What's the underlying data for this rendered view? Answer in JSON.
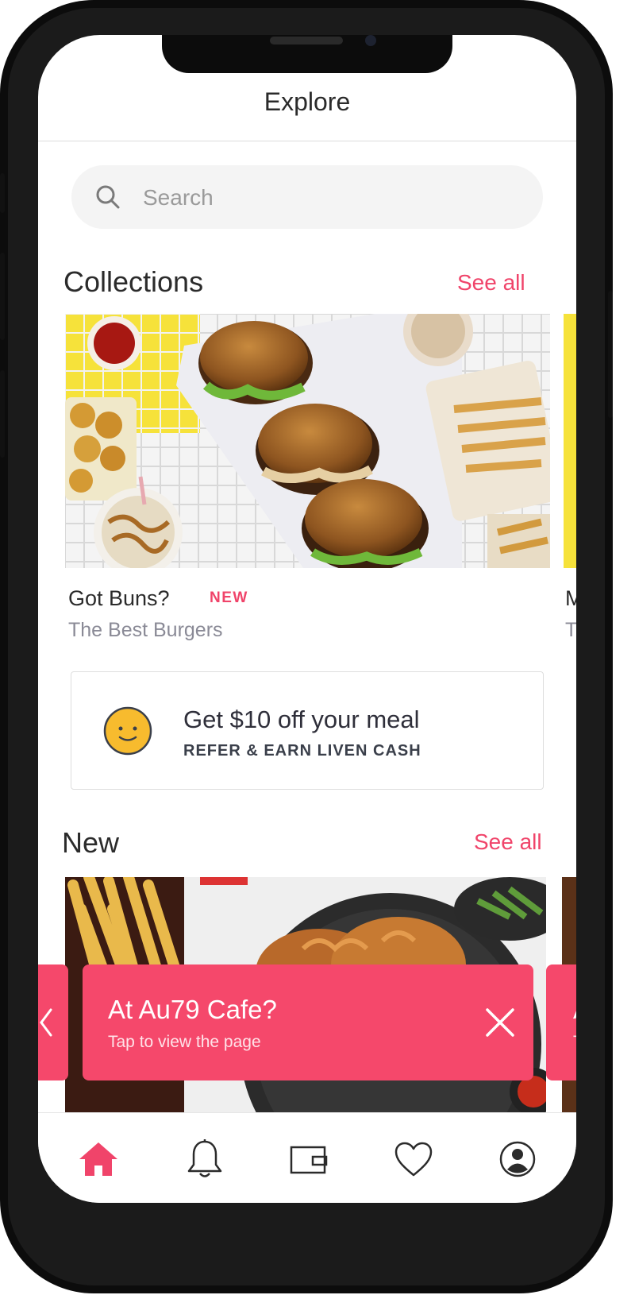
{
  "header": {
    "title": "Explore"
  },
  "search": {
    "placeholder": "Search"
  },
  "collections": {
    "title": "Collections",
    "see_all": "See all",
    "items": [
      {
        "name": "Got Buns?",
        "badge": "NEW",
        "subtitle": "The Best Burgers"
      },
      {
        "name": "M",
        "subtitle": "T"
      }
    ]
  },
  "promo": {
    "title": "Get $10 off your meal",
    "subtitle": "REFER & EARN LIVEN CASH"
  },
  "new_section": {
    "title": "New",
    "see_all": "See all"
  },
  "location_banner": {
    "title": "At Au79 Cafe?",
    "subtitle": "Tap to view the page",
    "next_peek_title": "A",
    "next_peek_subtitle": "T"
  },
  "tabbar": {
    "tabs": [
      {
        "icon": "home-icon",
        "active": true
      },
      {
        "icon": "bell-icon",
        "active": false
      },
      {
        "icon": "wallet-icon",
        "active": false
      },
      {
        "icon": "heart-icon",
        "active": false
      },
      {
        "icon": "profile-icon",
        "active": false
      }
    ]
  },
  "colors": {
    "accent": "#f0446a",
    "banner": "#f5486b",
    "text": "#2b2b2b",
    "muted": "#8a8a96"
  }
}
